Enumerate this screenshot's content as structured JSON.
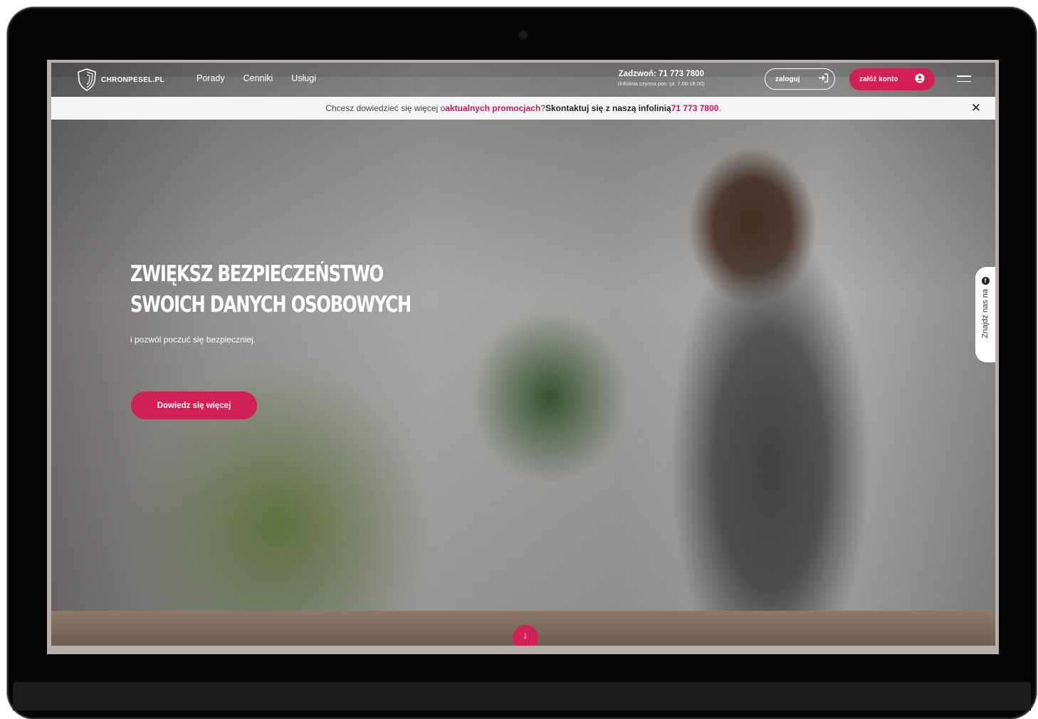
{
  "site": {
    "logo_text": "CHRONPESEL.PL"
  },
  "nav": {
    "items": [
      "Porady",
      "Cenniki",
      "Usługi"
    ]
  },
  "contact": {
    "phone_line": "Zadzwoń: 71 773 7800",
    "hours": "(infolinia czynna pon.-pt. 7.00-18.00)"
  },
  "header": {
    "login_label": "zaloguj",
    "register_label": "załóż konto"
  },
  "promo": {
    "text_before": "Chcesz dowiedzieć się więcej o ",
    "highlight": "aktualnych promocjach",
    "text_mid": "? ",
    "strong": "Skontaktuj się z naszą infolinią ",
    "phone": "71 773 7800",
    "text_end": "."
  },
  "hero": {
    "title_line1": "ZWIĘKSZ BEZPIECZEŃSTWO",
    "title_line2": "SWOICH DANYCH OSOBOWYCH",
    "subtitle": "i pozwól poczuć się bezpieczniej.",
    "cta_label": "Dowiedz się więcej"
  },
  "side_tab": {
    "label": "Znajdź nas na"
  },
  "icons": {
    "logo": "shield-icon",
    "login": "login-arrow-icon",
    "account": "user-icon",
    "menu": "hamburger-icon",
    "close": "close-icon",
    "facebook": "facebook-icon",
    "scroll": "arrow-down-icon"
  },
  "colors": {
    "accent": "#d11f57",
    "promo_highlight": "#c2185b"
  }
}
